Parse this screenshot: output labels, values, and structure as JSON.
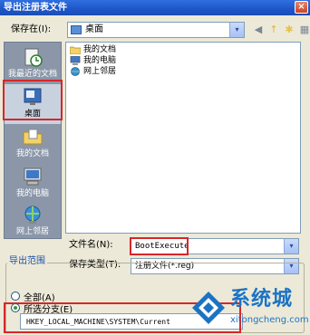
{
  "window": {
    "title": "导出注册表文件",
    "close_glyph": "×"
  },
  "save_in": {
    "label": "保存在(I):",
    "value": "桌面",
    "dropdown_glyph": "▾"
  },
  "toolbar": {
    "back_glyph": "◀",
    "up_glyph": "↑",
    "new_folder_glyph": "✱",
    "views_glyph": "▦"
  },
  "places": [
    {
      "label": "我最近的文档",
      "icon": "recent-docs-icon"
    },
    {
      "label": "桌面",
      "icon": "desktop-icon"
    },
    {
      "label": "我的文档",
      "icon": "my-documents-icon"
    },
    {
      "label": "我的电脑",
      "icon": "my-computer-icon"
    },
    {
      "label": "网上邻居",
      "icon": "network-places-icon"
    }
  ],
  "files": [
    {
      "name": "我的文档",
      "icon": "folder-icon"
    },
    {
      "name": "我的电脑",
      "icon": "computer-icon"
    },
    {
      "name": "网上邻居",
      "icon": "network-icon"
    }
  ],
  "filename": {
    "label": "文件名(N):",
    "value": "BootExecute",
    "dropdown_glyph": "▾"
  },
  "filetype": {
    "label": "保存类型(T):",
    "value": "注册文件(*.reg)",
    "dropdown_glyph": "▾"
  },
  "export_range": {
    "title": "导出范围",
    "all_label": "全部(A)",
    "branch_label": "所选分支(E)",
    "branch_value": "HKEY_LOCAL_MACHINE\\SYSTEM\\Current"
  },
  "watermark": {
    "text": "系统城",
    "url": "xitongcheng.com"
  },
  "colors": {
    "highlight": "#d7262a",
    "title_bar": "#1e55c8",
    "watermark": "#1b73c4"
  }
}
